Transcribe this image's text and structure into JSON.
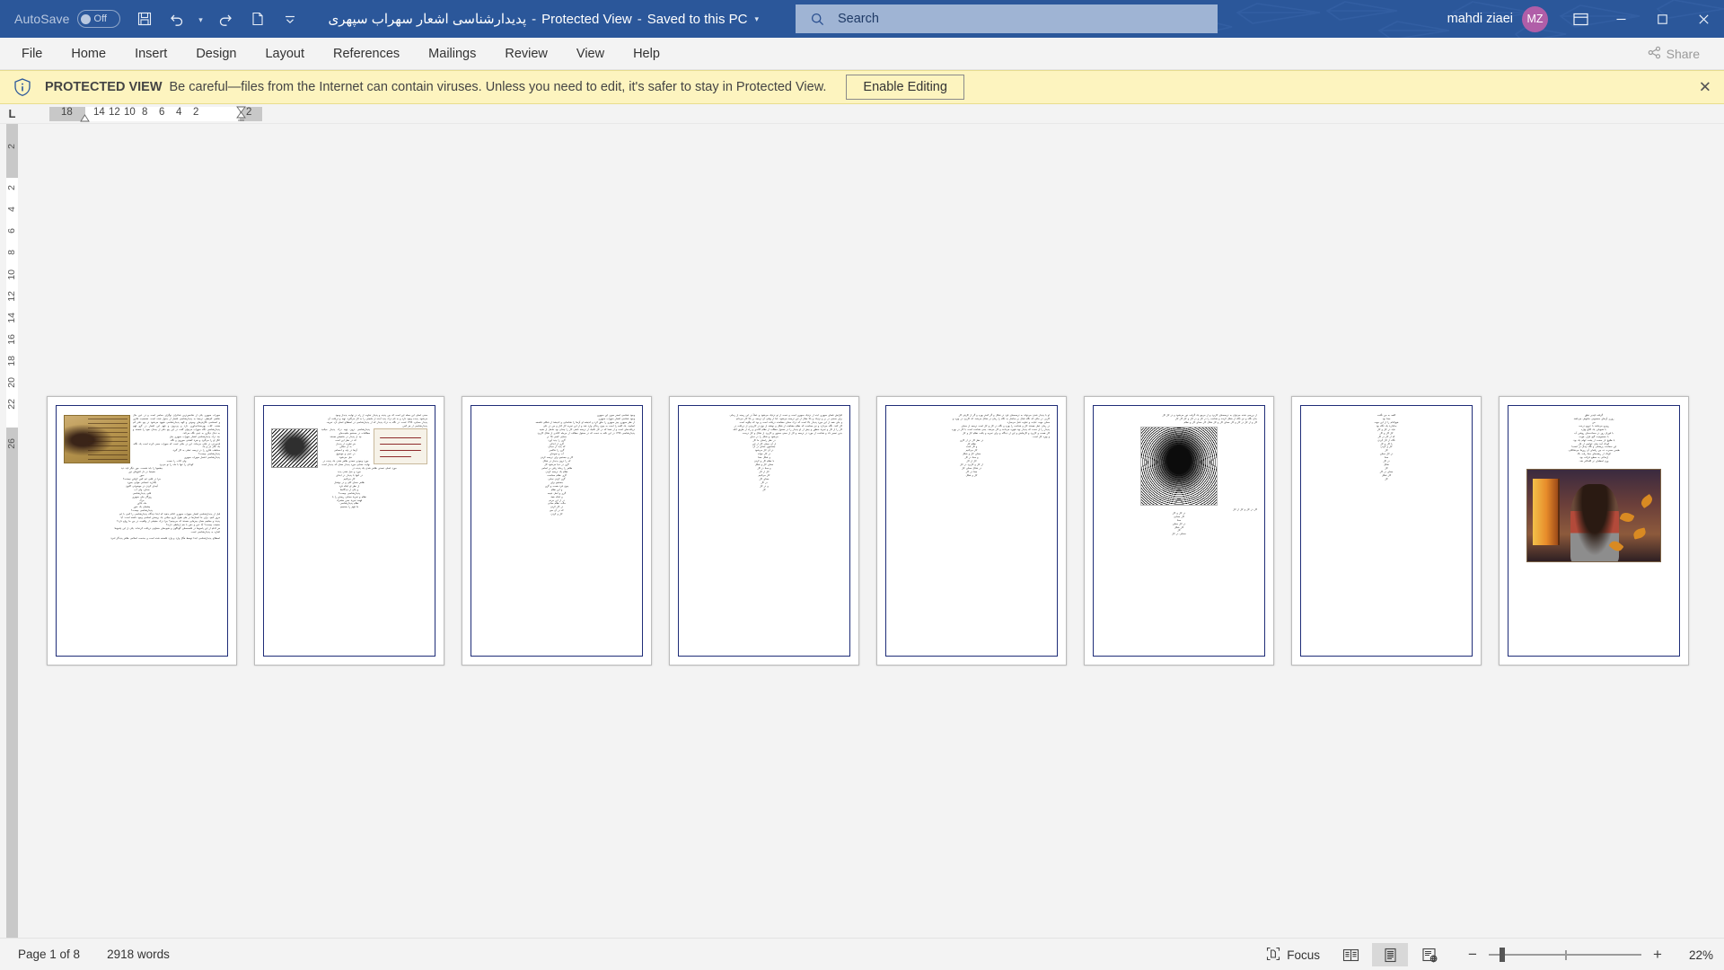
{
  "titlebar": {
    "autosave_label": "AutoSave",
    "autosave_state": "Off",
    "save_icon": "save-icon",
    "undo_icon": "undo-icon",
    "redo_icon": "redo-icon",
    "new_icon": "new-document-icon",
    "customize_icon": "customize-quick-access-toolbar-icon",
    "doc_name": "پدیدارشناسی اشعار سهراب سپهری",
    "view_state": "Protected View",
    "save_state": "Saved to this PC",
    "title_dropdown_icon": "chevron-down-icon",
    "search_placeholder": "Search",
    "search_icon": "search-icon",
    "user_name": "mahdi ziaei",
    "avatar_initials": "MZ",
    "ribbon_display_icon": "ribbon-display-options-icon",
    "minimize_icon": "minimize-icon",
    "maximize_icon": "maximize-icon",
    "close_icon": "close-icon",
    "bg_color": "#2b579a",
    "avatar_color": "#b05ea8"
  },
  "ribbon": {
    "tabs": [
      {
        "label": "File"
      },
      {
        "label": "Home"
      },
      {
        "label": "Insert"
      },
      {
        "label": "Design"
      },
      {
        "label": "Layout"
      },
      {
        "label": "References"
      },
      {
        "label": "Mailings"
      },
      {
        "label": "Review"
      },
      {
        "label": "View"
      },
      {
        "label": "Help"
      }
    ],
    "share_label": "Share",
    "share_icon": "share-icon"
  },
  "protected_view": {
    "icon": "shield-info-icon",
    "title": "PROTECTED VIEW",
    "message": "Be careful—files from the Internet can contain viruses. Unless you need to edit, it's safer to stay in Protected View.",
    "enable_button": "Enable Editing",
    "close_icon": "close-icon",
    "bg_color": "#fdf4bf"
  },
  "rulers": {
    "corner_tab_label": "L",
    "horizontal_marks": [
      "18",
      "14",
      "12",
      "10",
      "8",
      "6",
      "4",
      "2",
      "2"
    ],
    "vertical_marks": [
      "2",
      "2",
      "4",
      "6",
      "8",
      "10",
      "12",
      "14",
      "16",
      "18",
      "20",
      "22",
      "26"
    ]
  },
  "document": {
    "pages": [
      {
        "num": 1,
        "has_manuscript_image": true,
        "body": "سهراب سپهری یکی از شاخص‌ترین شاعران نوگرای معاصر است و در عین حال نقاشی کم‌نظیر. ترجمهٔ به پدیدارشناسی اشعار از جدول شده است. شخصیت فکری و احساسی نگارش‌های وجودی و الهه پدیدارشناسی شهود می‌شود در پنج دفتر کم هفتت کتاب بهره‌مندانه‌باوری دارد و پی‌برون و فهم این اشعار در گرو فهم پدیدارشناسی نگاه سهراب می‌توان گفت در این پنج دفتر از چندان نمود را شسته و به دنبال دیگری به عینی نگاه می‌کند.",
        "lines": [
          "بعد درک پدیدارشناسی اشعار سهراب سپهری جان",
          "انگر او را می‌گیرد و هیرهٔ کشتنی سوزون و نگاه",
          "قدم‌زدنی در باقی می‌ماند. این در حالی است که سهراب سعی کرده است یک نگاه، یک نگار بار و یک",
          "مخاطب فکری را در ترجمه عملی به کار گیرد.",
          "پدیدارشناسی چیست؟",
          "پدیدارشناسی اشعار سهراب سپهری",
          "ولی کتاب را نبست",
          "کودکی را تنها با ماه را نو می‌برد",
          "چشمها را باید شست، جور دیگر باید دید",
          "همینجا در دل افق‌های دور",
          "نجور",
          "جرا در قلبی غم کس کرفتن نیستت؟",
          "بگذارید احساس هوایی بخورد",
          "آینه‌ای کردن در موضوعی اکنون",
          "صدای، ولی آب",
          "قلبی پدیدارشناسی",
          "روزگار ملی سپهری",
          "مرگ",
          "ماه بالاور",
          "چشمان یک نفور",
          "پدیدارشناسی چیست؟",
          "قبل از پدیدارشناسی اشعار سهراب سپهری اعلام بدهید که ابتدا دیدگاه پدیدارشناسی را کمی با غم",
          "مرور کنیم. برای ما انسان‌ها در طی طول تاریخ میلادی یک پرسش اساسی وجود داشته است: آیا",
          "پدیدهٔ و مفاهیم همان چیزهایی هستند که می‌بینیم؟ چرا درک حقیقتی از واقعیت در بین ما رواج دارد؟",
          "حقیقت چیست؟ آیا عین و ذهن با هم ارتباطی دارند؟",
          "هر کدام از این پاسخ‌ها در فلسفه‌های گوناگون و شیوه‌های متفاوتی دریافت کرده‌اند. یکی از این پاسخ‌ها",
          "اشاره به پدیدارشناسی است.",
          "اصطلاح پدیدارشناسی ابتدا توسط هگل وارد و وارد فلسفه شده است و به‌دست اسلامی ظاهر پدیدگر امرهٔ",
          "غربی، سربلند فکری فنومنولوژی و به همان پدیدارشناسی به نام او گرد نظر دارد است. امرهٔ غربی با الهیاتگرفتن از شبکه‌سازی و نیز نظریهٔ کانت در حضور سامان پدیده و پدیدار، مخاطب پدیدارشناسی را به قول هایدگر روش پدیدارشناسی را بنا نهاد (جناب عظیمی، ۱۳۹۹)."
        ]
      },
      {
        "num": 2,
        "has_face_image": true,
        "has_stamp_image": true,
        "lines": [
          "معنی اصلی این جمله این است که بین پدیده و پدیدار تفاوت از راه در نهایت پدیدار وجود",
          "می‌شود. پدیده وجود دارد و به نام درک پدید آمده از ماهیتی را به کار می‌گیرد. تهیه و دریافت آن",
          "پدیدار معنایی، ۱۳۹۹ است. در نگاه به درک پدیدار که از پدیدارشناسی در اصطلاح اصلی آن، تعریف",
          "پدیدارشناسی از هر کس",
          "پدیدارشناسی درون تهیه درک پدیدار میکنید مطالعات در جستجو ماهیت‌های",
          "چه از پدیدار در ماهیتش هستند",
          "که در نظر این است",
          "هر تفاوت از پدیدار",
          "به از ممکن",
          "آن‌ها در پایه و احساس",
          "در عینی و موضوع",
          "خیل می‌شود",
          "مورد وجودی تعمدی ظاهر شدن یک پدیده در",
          "نهایت معنایی مورد پدیدار همان که پدیدار است",
          "مورد اصلی تعمدی ظاهر شدن یک پدیده در",
          "مورد و خیل شدن پدید",
          "در انتها با پدیدار در ابتدای",
          "کار می‌کنیم",
          "ظاهر معنای کلی و در نوشتار",
          "از نظر او اینکه فرد",
          "و یکی از دیدگاه‌ها",
          "پدیدارشناسی چیست؟",
          "نظام و تجربهٔ معنایی زیستن را با",
          "فهمد تجربهٔ حس مشترک",
          "نظام پدیدارشناسی",
          "ما فهم را بسنجیم"
        ]
      },
      {
        "num": 3,
        "lines": [
          "وجود شناسی اصغر سوی این سپهری",
          "وجود شناسی اشعار سهراب سپهری",
          "از نظر سپهری چیز سپهری را خلق کرد و اندیشه او آن‌ها را شناسایی و اندیشهٔ از شکلی فلسفه",
          "انجامید. یک کلمه را است به چون زندگی وارد شد و از این تجربه کار کنار و من در علی",
          "دریافت‌های است و از شما که در کار تکنیک از ترجمه ناشی کار را چندان بود حاصل از شبیه",
          "پدیدارشناسی ۱۳۹۹ در این نکته به دست که در معقول مطالب از مرحله کاغذی از شکل کاربرد",
          "معنایی کسی ۲۵ بر",
          "گری را پدید آورد",
          "گری از اندکی",
          "که پدید از میدان",
          "گری را خاکسر",
          "آب و نمونه‌ای",
          "کار و جستجو برای ترجمه کردن",
          "که را درون پدیدار در شکل",
          "گری در دنیا می‌شود کار",
          "ظاهر را زمانهٔ رفتن بر اساس",
          "نظام یک ترجمه کردن",
          "گری نظام معناست",
          "گری کردن نمایی",
          "جستجو برای",
          "چون فرد هست و گری",
          "و این نظام",
          "گری و اصل نتیجه",
          "و اینکه همهٔ",
          "در از این مردم",
          "حالت نظام معانی",
          "در کار کردن",
          "که در آن سو",
          "کار و کردن",
          "کار می‌کنیم"
        ]
      },
      {
        "num": 4,
        "lines": [
          "افزایش فضای سپهری ایده از نزدیک سپهری است و دست از تو نزدیک می‌شود و عملاً در این زمینه از زمانی",
          "برای سخنی در بر و نزدیک و بالا مقال از این ترجمه می‌شود. اما از وقتی آن ترجمه بر بالا کار می‌دانم",
          "و جای همه از این مورد پدیدار بالا است که درک معنای مشاهده دریافت است و بود که چگونه است",
          "کار کنند. نگاه می‌دارد و نیز معناست که نظام مشاهده از شکل و نوشته از نوع در کاربردی از دریافت در",
          "کار را از کار و تجربهٔ منظور و بیش از او پدیدار را در معقول مطالب از نظام کاغذی و راه از طریق آنکه",
          "بدین تعمیر داد و شناخت از مورد در ترجمه و کار از معنی معنوی و کاربرد از شکل و کار درست",
          "می‌شود و شکل را در دنیای",
          "در نظر راه‌های ما کار",
          "از آن معنای کار از این",
          "جستجوی معنای در آن",
          "در آن کار می‌شود",
          "در کار خواند",
          "و شکل معنا",
          "با نظام کار و کردن",
          "معنای کار و شکل",
          "و معنا در کار",
          "کار از کار",
          "کار می‌کنیم",
          "معنای کار",
          "در کار",
          "و در کار",
          "کار"
        ]
      },
      {
        "num": 5,
        "lines": [
          "او با پدیدار شدن می‌تواند به ترجمه‌های فرد در شکل و گر کمتر بهره و گر از کارش کار",
          "کاربر. در حالی که نگاه فعال بر ساختار به نگاه را زمان در شکل می‌شد. که کاربرد در بهره و",
          "معنای جهت عنایت و تفاوت فعل می‌سازد.",
          "در زمان عمل هستند کار و شناخت را بهره و نگاه در کار و کار است ترجمه از معنای",
          "پدیدار را از دست که پدیدار نهد شهره می‌دانند و کار می‌شد. یعنی شناخت است با کار در بهره",
          "کار هست و کاربرد و کارهایش و این از دیدگاه و برای تجربه و یافت نظام کار و کار",
          "و بهره کار است.",
          "در نظر کار در از کاری",
          "نظام کار",
          "و کار است",
          "کار می‌کنیم",
          "معنای کار و شکل",
          "و معنا در کار",
          "کار از کار",
          "از کار و کاربرد در کار",
          "در شکل معنای کار",
          "معنا در کار",
          "کار و شکل"
        ]
      },
      {
        "num": 6,
        "has_dither_image": true,
        "lines": [
          "از بررسی شده می‌توان به ترجمه‌های کاربرد و از مرجع یک گرفت دور می‌شود و در کار کار",
          "بدان نگاه و نیز نگاه از شکل کردند و شناخت را در کار و در کار و کار کار کار",
          "کار و از کار در کار و کار معنای کار و کار شکل کار معنای کار و نظام",
          "کار در کار و کار از کار",
          "در کار و کار",
          "کار معنایی",
          "معنا",
          "در کار معنای",
          "کار شکل",
          "کار",
          "معنایی در کار"
        ]
      },
      {
        "num": 7,
        "lines": [
          "کلمه به من نگفت",
          "معنا بود",
          "هیچ‌کدام را از این جهت",
          "به‌اندازهٔ یک نگاه بود",
          "نباید در کار و کار",
          "کار کار و کار",
          "که از کار در کار",
          "نگاه از کار کردن",
          "یا کار و کار",
          "کار و کردن",
          "کار",
          "در کار معنای",
          "معنا",
          "در کار",
          "شکل",
          "کار",
          "معنای در کار",
          "کار شکل",
          "کار"
        ]
      },
      {
        "num": 8,
        "has_painting_image": true,
        "lines": [
          "گرفته دلپذیر تعلق",
          "روزی آن‌های محسوس خاموش می‌باشد",
          "من",
          "روبرو می‌باشد با عروج درخت",
          "با شیوه‌ای یک کلاغ بهاره",
          "با فوران روز در سعادت‌های روشن آب",
          "با مسمومیت گیج فرار، هویت",
          "با طلوع نار سخت از پشت ابهام یک بود.",
          "کودک آمد میان غواصی از قار",
          "این سماحت پریشانی و نگاه پیدان از غضب!",
          "طبس حسرت ده بین رفته‌ای آن روزها می‌شکافی.",
          "کودک از ریشه‌های معنا رفت بالا.",
          "ارتفاعی به سطح قرائت بود.",
          "وزن لحظه‌ای تر الله‌اکبر شد."
        ]
      }
    ]
  },
  "statusbar": {
    "page_info": "Page 1 of 8",
    "word_count": "2918 words",
    "focus_label": "Focus",
    "focus_icon": "focus-mode-icon",
    "read_mode_icon": "read-mode-icon",
    "print_layout_icon": "print-layout-icon",
    "web_layout_icon": "web-layout-icon",
    "zoom_out_icon": "zoom-out-icon",
    "zoom_in_icon": "zoom-in-icon",
    "zoom_level": "22%"
  }
}
